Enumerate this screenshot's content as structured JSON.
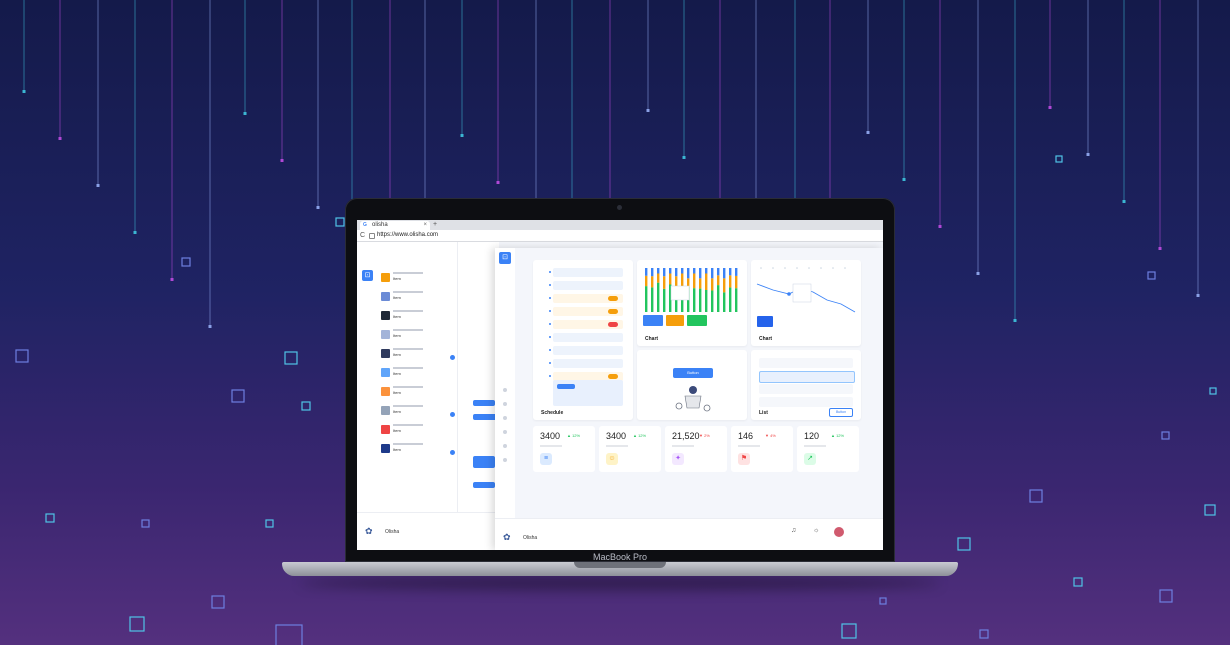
{
  "colors": {
    "accent": "#3b82f6",
    "bg_top": "#141a4a",
    "bg_bottom": "#54307e",
    "green": "#22c55e",
    "red": "#ef4444",
    "orange": "#f59e0b"
  },
  "laptop": {
    "brand": "MacBook Pro"
  },
  "browser": {
    "tab_title": "olisha",
    "favicon": "G",
    "tab_close": "×",
    "new_tab": "+",
    "reload": "C",
    "url": "https://www.olisha.com"
  },
  "back_app": {
    "logo": "⊡",
    "brand": "Olisha",
    "items": [
      {
        "title": "Item"
      },
      {
        "title": "Item"
      },
      {
        "title": "Item"
      },
      {
        "title": "Item"
      },
      {
        "title": "Item"
      },
      {
        "title": "Item"
      },
      {
        "title": "Item"
      },
      {
        "title": "Item"
      },
      {
        "title": "Item"
      },
      {
        "title": "Item"
      }
    ]
  },
  "dashboard": {
    "logo": "⊡",
    "cards": {
      "schedule": {
        "title": "Schedule"
      },
      "chart_a": {
        "title": "Chart"
      },
      "chart_b": {
        "title": "Chart"
      },
      "center": {
        "button_label": "Button"
      },
      "list": {
        "title": "List",
        "button_label": "Button"
      }
    },
    "stats_a": [
      "",
      "",
      ""
    ],
    "stats_b": [
      "",
      "",
      "",
      ""
    ],
    "kpis": [
      {
        "value": "3400",
        "delta": "▲ 12%",
        "color": "#22c55e",
        "icon": "≡",
        "icon_bg": "#dbeafe",
        "icon_color": "#3b82f6"
      },
      {
        "value": "3400",
        "delta": "▲ 12%",
        "color": "#22c55e",
        "icon": "☺",
        "icon_bg": "#fef3c7",
        "icon_color": "#f59e0b"
      },
      {
        "value": "21,520",
        "delta": "▼ 2%",
        "color": "#ef4444",
        "icon": "✦",
        "icon_bg": "#f3e8ff",
        "icon_color": "#a855f7"
      },
      {
        "value": "146",
        "delta": "▼ 4%",
        "color": "#ef4444",
        "icon": "⚑",
        "icon_bg": "#fee2e2",
        "icon_color": "#ef4444"
      },
      {
        "value": "120",
        "delta": "▲ 12%",
        "color": "#22c55e",
        "icon": "↗",
        "icon_bg": "#dcfce7",
        "icon_color": "#22c55e"
      }
    ],
    "footer": {
      "brand": "Olisha",
      "user": "",
      "bell": "♫",
      "settings": "☼"
    }
  }
}
